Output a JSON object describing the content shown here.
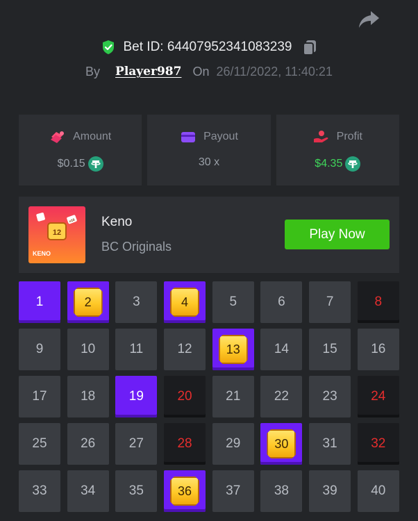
{
  "header": {
    "bet_id_label": "Bet ID: 64407952341083239",
    "by_label": "By",
    "player_name": "Player987",
    "on_label": "On",
    "date": "26/11/2022, 11:40:21",
    "icons": {
      "share": "share-arrow-icon",
      "verified": "shield-check-icon",
      "copy": "copy-icon"
    }
  },
  "stats": [
    {
      "label": "Amount",
      "value": "$0.15",
      "icon": "coins-icon",
      "currency_icon": "tether-icon"
    },
    {
      "label": "Payout",
      "value": "30 x",
      "icon": "wallet-card-icon"
    },
    {
      "label": "Profit",
      "value": "$4.35",
      "icon": "hand-profit-icon",
      "currency_icon": "tether-icon"
    }
  ],
  "game": {
    "name": "Keno",
    "provider": "BC Originals",
    "play_button": "Play Now",
    "thumb_label": "KENO",
    "thumb_number": "12",
    "thumb_mini": "x10"
  },
  "colors": {
    "background": "#232528",
    "panel": "#2d2f33",
    "selected": "#6d1ef7",
    "drawn_text": "#e52d2d",
    "profit_green": "#3fd45a",
    "play_button": "#3bc117"
  },
  "keno_grid": {
    "cells": [
      {
        "n": "1",
        "state": "selected"
      },
      {
        "n": "2",
        "state": "hit"
      },
      {
        "n": "3",
        "state": "normal"
      },
      {
        "n": "4",
        "state": "hit"
      },
      {
        "n": "5",
        "state": "normal"
      },
      {
        "n": "6",
        "state": "normal"
      },
      {
        "n": "7",
        "state": "normal"
      },
      {
        "n": "8",
        "state": "drawn"
      },
      {
        "n": "9",
        "state": "normal"
      },
      {
        "n": "10",
        "state": "normal"
      },
      {
        "n": "11",
        "state": "normal"
      },
      {
        "n": "12",
        "state": "normal"
      },
      {
        "n": "13",
        "state": "hit"
      },
      {
        "n": "14",
        "state": "normal"
      },
      {
        "n": "15",
        "state": "normal"
      },
      {
        "n": "16",
        "state": "normal"
      },
      {
        "n": "17",
        "state": "normal"
      },
      {
        "n": "18",
        "state": "normal"
      },
      {
        "n": "19",
        "state": "selected"
      },
      {
        "n": "20",
        "state": "drawn"
      },
      {
        "n": "21",
        "state": "normal"
      },
      {
        "n": "22",
        "state": "normal"
      },
      {
        "n": "23",
        "state": "normal"
      },
      {
        "n": "24",
        "state": "drawn"
      },
      {
        "n": "25",
        "state": "normal"
      },
      {
        "n": "26",
        "state": "normal"
      },
      {
        "n": "27",
        "state": "normal"
      },
      {
        "n": "28",
        "state": "drawn"
      },
      {
        "n": "29",
        "state": "normal"
      },
      {
        "n": "30",
        "state": "hit"
      },
      {
        "n": "31",
        "state": "normal"
      },
      {
        "n": "32",
        "state": "drawn"
      },
      {
        "n": "33",
        "state": "normal"
      },
      {
        "n": "34",
        "state": "normal"
      },
      {
        "n": "35",
        "state": "normal"
      },
      {
        "n": "36",
        "state": "hit"
      },
      {
        "n": "37",
        "state": "normal"
      },
      {
        "n": "38",
        "state": "normal"
      },
      {
        "n": "39",
        "state": "normal"
      },
      {
        "n": "40",
        "state": "normal"
      }
    ]
  }
}
